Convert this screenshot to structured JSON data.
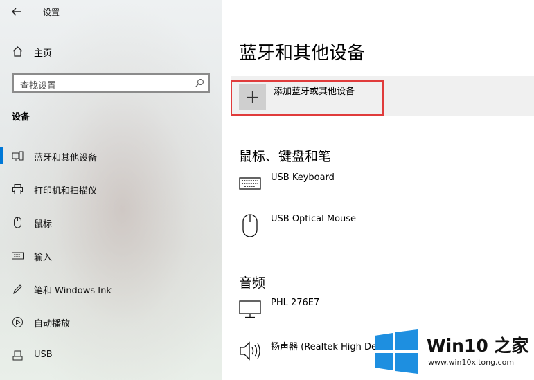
{
  "window": {
    "title": "设置"
  },
  "sidebar": {
    "home_label": "主页",
    "search_placeholder": "查找设置",
    "section_title": "设备",
    "items": [
      {
        "label": "蓝牙和其他设备",
        "icon": "bluetooth-devices-icon",
        "active": true
      },
      {
        "label": "打印机和扫描仪",
        "icon": "printer-icon",
        "active": false
      },
      {
        "label": "鼠标",
        "icon": "mouse-icon",
        "active": false
      },
      {
        "label": "输入",
        "icon": "keyboard-icon",
        "active": false
      },
      {
        "label": "笔和 Windows Ink",
        "icon": "pen-icon",
        "active": false
      },
      {
        "label": "自动播放",
        "icon": "autoplay-icon",
        "active": false
      },
      {
        "label": "USB",
        "icon": "usb-icon",
        "active": false
      }
    ]
  },
  "main": {
    "title": "蓝牙和其他设备",
    "add_device_label": "添加蓝牙或其他设备",
    "groups": [
      {
        "title": "鼠标、键盘和笔",
        "devices": [
          {
            "name": "USB Keyboard",
            "icon": "keyboard-icon"
          },
          {
            "name": "USB Optical Mouse",
            "icon": "mouse-icon"
          }
        ]
      },
      {
        "title": "音频",
        "devices": [
          {
            "name": "PHL 276E7",
            "icon": "monitor-icon"
          },
          {
            "name": "扬声器 (Realtek High De",
            "icon": "speaker-icon"
          }
        ]
      }
    ]
  },
  "watermark": {
    "brand": "Win10 之家",
    "url": "www.win10xitong.com"
  },
  "colors": {
    "accent": "#0078d7",
    "highlight_border": "#e03b3b",
    "logo_blue": "#1e8fe0"
  }
}
